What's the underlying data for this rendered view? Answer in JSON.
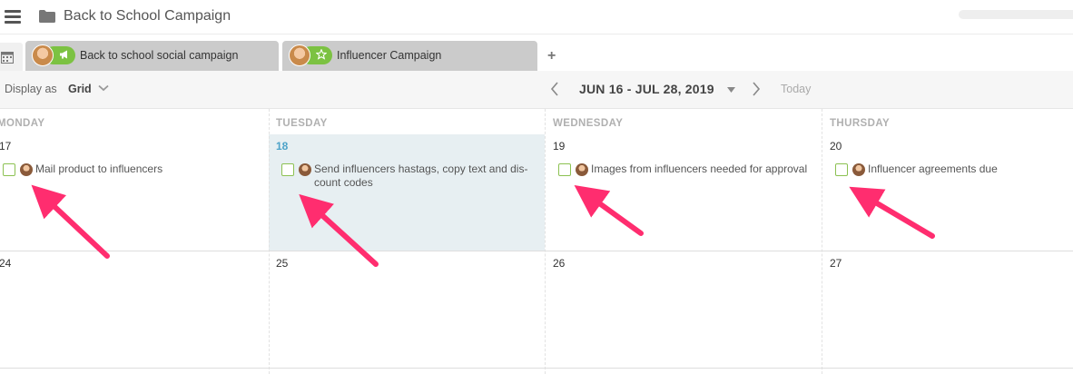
{
  "header": {
    "menu_icon": "hamburger-icon",
    "folder_icon": "folder-icon",
    "title": "Back to School Campaign"
  },
  "tabs": [
    {
      "label": "Back to school social campaign",
      "icon": "megaphone-icon",
      "accent": "#7cc242"
    },
    {
      "label": "Influencer Campaign",
      "icon": "star-icon",
      "accent": "#7cc242"
    }
  ],
  "toolbar": {
    "display_as_label": "Display as",
    "display_value": "Grid",
    "date_range": "JUN 16 - JUL 28, 2019",
    "today_label": "Today"
  },
  "calendar": {
    "days": [
      "MONDAY",
      "TUESDAY",
      "WEDNESDAY",
      "THURSDAY"
    ],
    "week1": {
      "dates": [
        "17",
        "18",
        "19",
        "20"
      ],
      "today_index": 1,
      "tasks": [
        {
          "label": "Mail product to influencers"
        },
        {
          "label": "Send influencers hastags, copy text and dis-\ncount codes"
        },
        {
          "label": "Images from influencers needed for approval"
        },
        {
          "label": "Influencer agreements due"
        }
      ]
    },
    "week2": {
      "dates": [
        "24",
        "25",
        "26",
        "27"
      ]
    }
  },
  "colors": {
    "today_highlight": "#e7eff2",
    "today_text": "#4ea3c9",
    "checkbox_border": "#8cc152",
    "annotation_arrow": "#ff2d6f"
  }
}
